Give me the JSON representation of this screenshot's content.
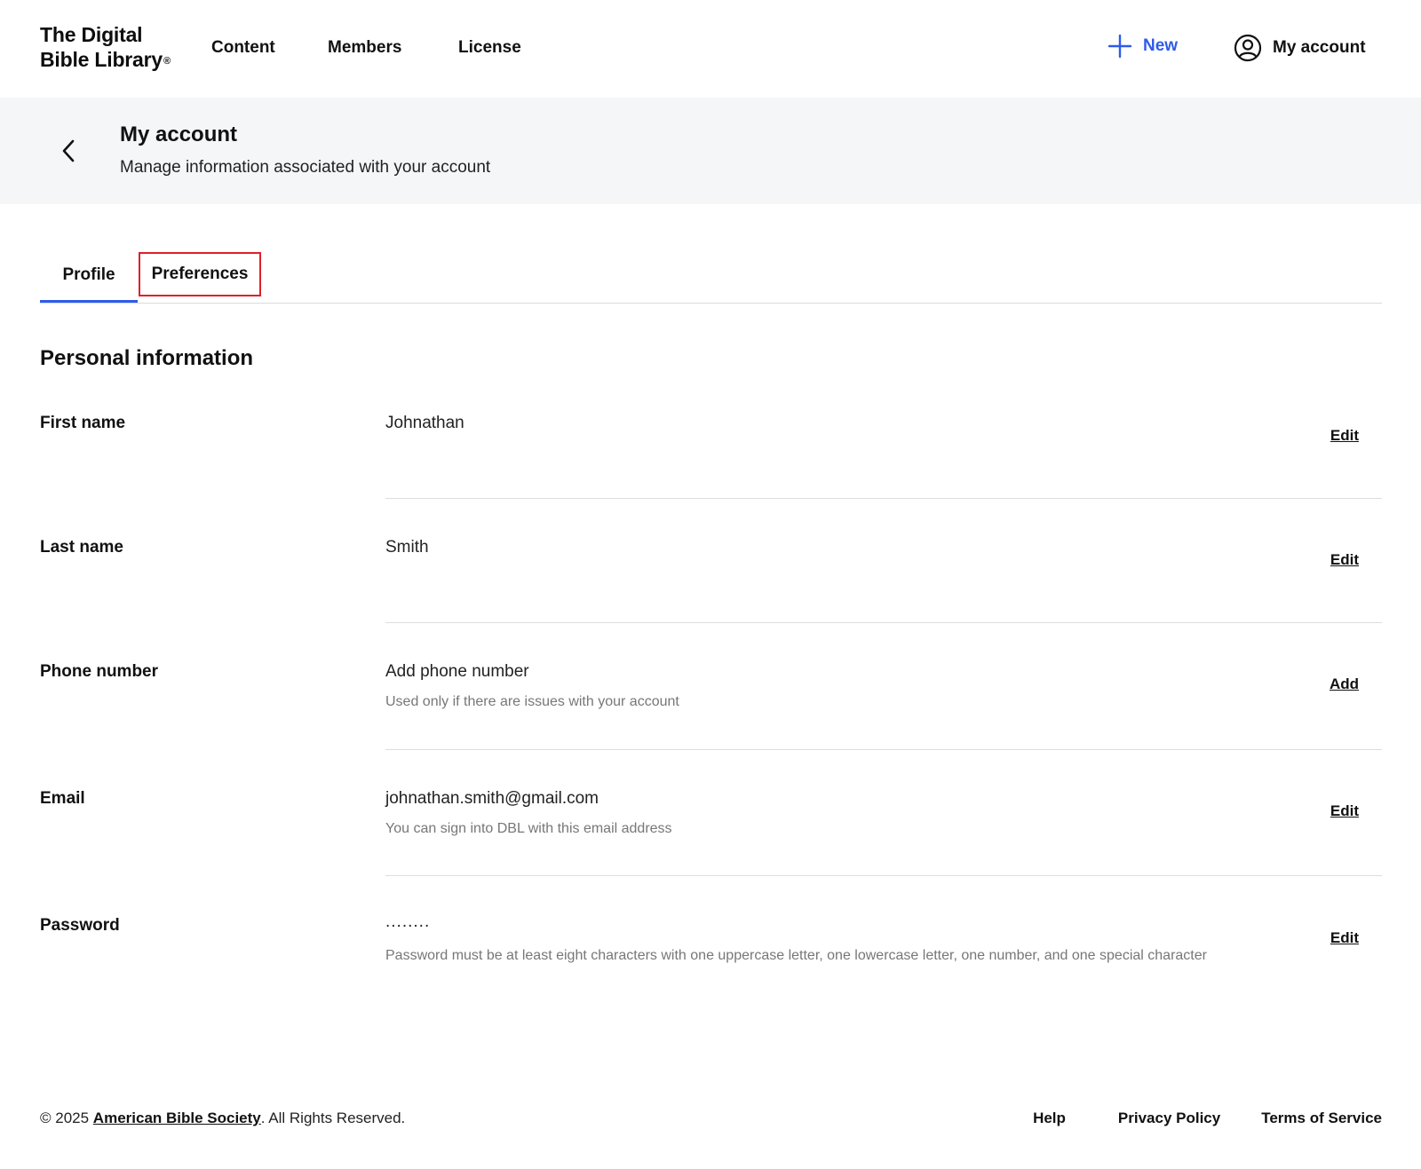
{
  "header": {
    "logo_line1": "The Digital",
    "logo_line2": "Bible Library",
    "logo_reg": "®",
    "nav": [
      {
        "label": "Content"
      },
      {
        "label": "Members"
      },
      {
        "label": "License"
      }
    ],
    "new_label": "New",
    "account_label": "My account"
  },
  "banner": {
    "title": "My account",
    "subtitle": "Manage information associated with your account"
  },
  "tabs": [
    {
      "label": "Profile",
      "active": true
    },
    {
      "label": "Preferences",
      "active": false
    }
  ],
  "section": {
    "title": "Personal information",
    "rows": [
      {
        "label": "First name",
        "value": "Johnathan",
        "hint": "",
        "action": "Edit"
      },
      {
        "label": "Last name",
        "value": "Smith",
        "hint": "",
        "action": "Edit"
      },
      {
        "label": "Phone number",
        "value": "Add phone number",
        "hint": "Used only if there are issues with your account",
        "action": "Add"
      },
      {
        "label": "Email",
        "value": "johnathan.smith@gmail.com",
        "hint": "You can sign into DBL with this email address",
        "action": "Edit"
      },
      {
        "label": "Password",
        "value": "........",
        "hint": "Password must be at least eight characters with one uppercase letter, one lowercase letter, one number, and one special character",
        "action": "Edit"
      }
    ]
  },
  "footer": {
    "copy_prefix": "© 2025 ",
    "copy_link": "American Bible Society",
    "copy_suffix": ". All Rights Reserved.",
    "links": [
      {
        "label": "Help"
      },
      {
        "label": "Privacy Policy"
      },
      {
        "label": "Terms of Service"
      }
    ]
  },
  "colors": {
    "accent": "#2f5bea",
    "highlight_border": "#e0202a",
    "banner_bg": "#f5f6f7"
  },
  "icons": {
    "plus": "plus-icon",
    "account": "user-circle-icon",
    "back": "chevron-left-icon"
  }
}
